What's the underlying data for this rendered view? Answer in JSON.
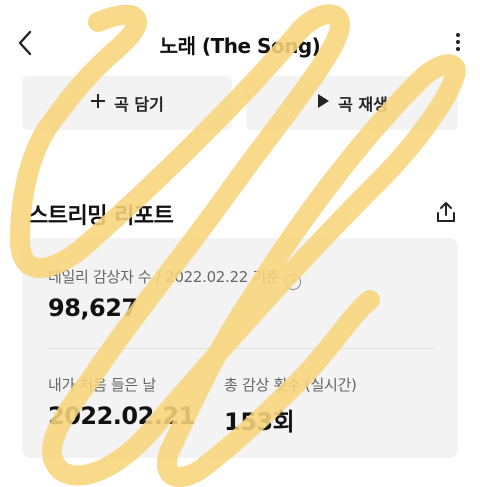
{
  "header": {
    "title": "노래 (The Song)"
  },
  "actions": {
    "add_label": "곡 담기",
    "play_label": "곡 재생"
  },
  "report": {
    "title": "스트리밍 리포트",
    "daily_label": "데일리 감상자 수 / 2022.02.22 기준",
    "daily_value": "98,627",
    "first_label": "내가 처음 들은 날",
    "first_value": "2022.02.21",
    "total_label": "총 감상 횟수 (실시간)",
    "total_value": "153회"
  },
  "colors": {
    "scribble": "#f7d57a",
    "card_bg": "#f3f3f4",
    "button_bg": "#f3f3f4"
  },
  "icons": [
    "back-arrow-icon",
    "more-vertical-icon",
    "plus-icon",
    "play-icon",
    "share-icon",
    "info-icon"
  ]
}
